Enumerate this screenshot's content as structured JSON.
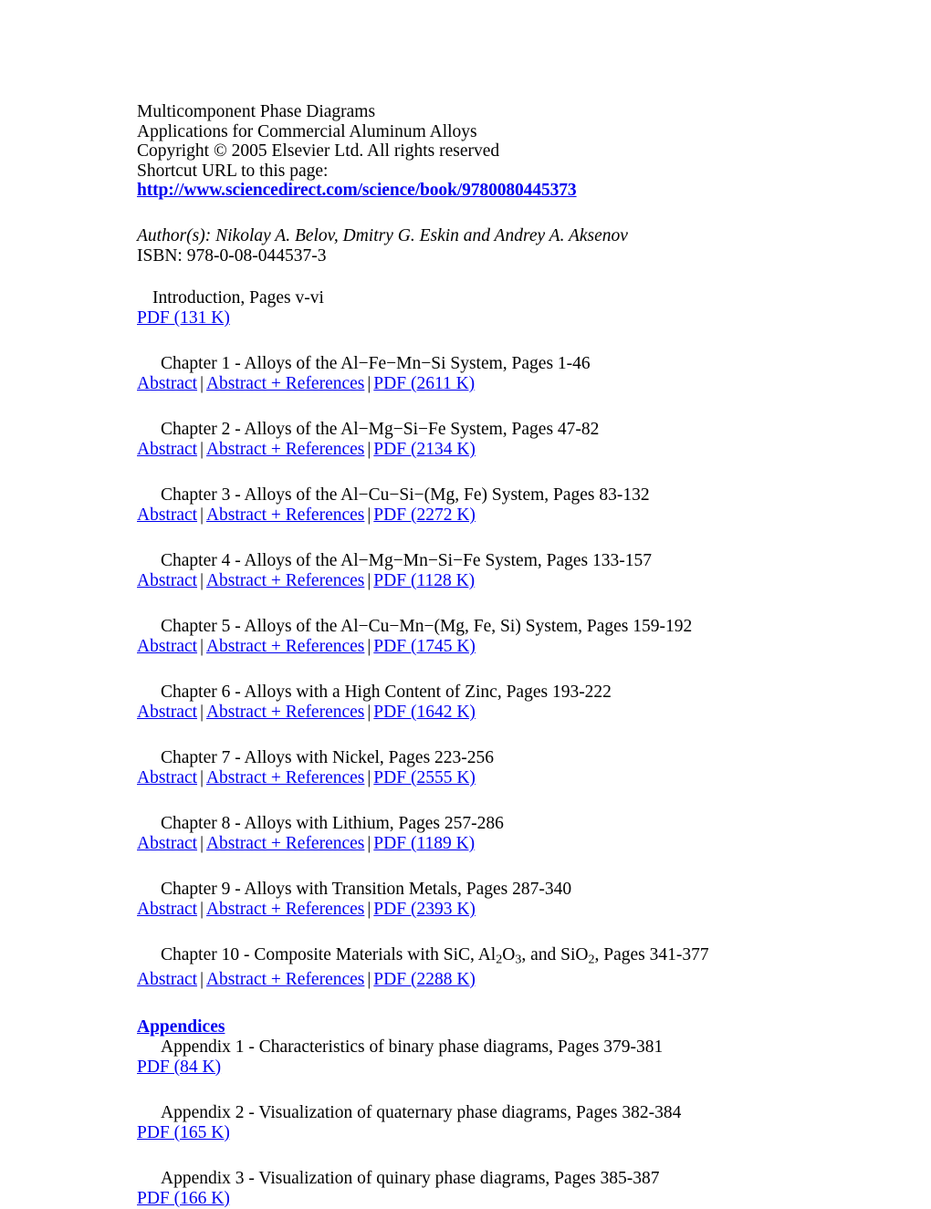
{
  "header": {
    "book_title": "Multicomponent Phase Diagrams",
    "subtitle": "Applications for Commercial Aluminum Alloys",
    "copyright": "Copyright © 2005 Elsevier Ltd. All rights reserved",
    "shortcut_label": "Shortcut URL to this page:",
    "url": "http://www.sciencedirect.com/science/book/9780080445373",
    "authors": "Author(s): Nikolay A. Belov, Dmitry G. Eskin and Andrey A. Aksenov",
    "isbn": "ISBN: 978-0-08-044537-3"
  },
  "link_color": "#0000EE",
  "text_color": "#000000",
  "separator": "|",
  "entries": [
    {
      "title": "Introduction, Pages v-vi",
      "links": [
        {
          "label": "PDF (131 K)",
          "kind": "pdf"
        }
      ]
    },
    {
      "title": "Chapter 1 - Alloys of the Al−Fe−Mn−Si System, Pages 1-46",
      "links": [
        {
          "label": "Abstract",
          "kind": "abstract"
        },
        {
          "label": "Abstract + References",
          "kind": "abstract-references"
        },
        {
          "label": "PDF (2611 K)",
          "kind": "pdf"
        }
      ]
    },
    {
      "title": "Chapter 2 - Alloys of the Al−Mg−Si−Fe System, Pages 47-82",
      "links": [
        {
          "label": "Abstract",
          "kind": "abstract"
        },
        {
          "label": "Abstract + References",
          "kind": "abstract-references"
        },
        {
          "label": "PDF (2134 K)",
          "kind": "pdf"
        }
      ]
    },
    {
      "title": "Chapter 3 - Alloys of the Al−Cu−Si−(Mg, Fe) System, Pages 83-132",
      "links": [
        {
          "label": "Abstract",
          "kind": "abstract"
        },
        {
          "label": "Abstract + References",
          "kind": "abstract-references"
        },
        {
          "label": "PDF (2272 K)",
          "kind": "pdf"
        }
      ]
    },
    {
      "title": "Chapter 4 - Alloys of the Al−Mg−Mn−Si−Fe System, Pages 133-157",
      "links": [
        {
          "label": "Abstract",
          "kind": "abstract"
        },
        {
          "label": "Abstract + References",
          "kind": "abstract-references"
        },
        {
          "label": "PDF (1128 K)",
          "kind": "pdf"
        }
      ]
    },
    {
      "title": "Chapter 5 - Alloys of the Al−Cu−Mn−(Mg, Fe, Si) System, Pages 159-192",
      "links": [
        {
          "label": "Abstract",
          "kind": "abstract"
        },
        {
          "label": "Abstract + References",
          "kind": "abstract-references"
        },
        {
          "label": "PDF (1745 K)",
          "kind": "pdf"
        }
      ]
    },
    {
      "title": "Chapter 6 - Alloys with a High Content of Zinc, Pages 193-222",
      "links": [
        {
          "label": "Abstract",
          "kind": "abstract"
        },
        {
          "label": "Abstract + References",
          "kind": "abstract-references"
        },
        {
          "label": "PDF (1642 K)",
          "kind": "pdf"
        }
      ]
    },
    {
      "title": "Chapter 7 - Alloys with Nickel, Pages 223-256",
      "links": [
        {
          "label": "Abstract",
          "kind": "abstract"
        },
        {
          "label": "Abstract + References",
          "kind": "abstract-references"
        },
        {
          "label": "PDF (2555 K)",
          "kind": "pdf"
        }
      ]
    },
    {
      "title": "Chapter 8 - Alloys with Lithium, Pages 257-286",
      "links": [
        {
          "label": "Abstract",
          "kind": "abstract"
        },
        {
          "label": "Abstract + References",
          "kind": "abstract-references"
        },
        {
          "label": "PDF (1189 K)",
          "kind": "pdf"
        }
      ]
    },
    {
      "title": "Chapter 9 - Alloys with Transition Metals, Pages 287-340",
      "links": [
        {
          "label": "Abstract",
          "kind": "abstract"
        },
        {
          "label": "Abstract + References",
          "kind": "abstract-references"
        },
        {
          "label": "PDF (2393 K)",
          "kind": "pdf"
        }
      ]
    },
    {
      "title_html": "Chapter 10 - Composite Materials with SiC, Al<sub>2</sub>O<sub>3</sub>, and SiO<sub>2</sub>, Pages 341-377",
      "title": "Chapter 10 - Composite Materials with SiC, Al2O3, and SiO2, Pages 341-377",
      "links": [
        {
          "label": "Abstract",
          "kind": "abstract"
        },
        {
          "label": "Abstract + References",
          "kind": "abstract-references"
        },
        {
          "label": "PDF (2288 K)",
          "kind": "pdf"
        }
      ]
    }
  ],
  "appendices": {
    "heading": "Appendices",
    "entries": [
      {
        "title": "Appendix 1 - Characteristics of binary phase diagrams, Pages 379-381",
        "links": [
          {
            "label": "PDF (84 K)",
            "kind": "pdf"
          }
        ]
      },
      {
        "title": "Appendix 2 - Visualization of quaternary phase diagrams, Pages 382-384",
        "links": [
          {
            "label": "PDF (165 K)",
            "kind": "pdf"
          }
        ]
      },
      {
        "title": "Appendix 3 - Visualization of quinary phase diagrams, Pages 385-387",
        "links": [
          {
            "label": "PDF (166 K)",
            "kind": "pdf"
          }
        ]
      }
    ]
  }
}
